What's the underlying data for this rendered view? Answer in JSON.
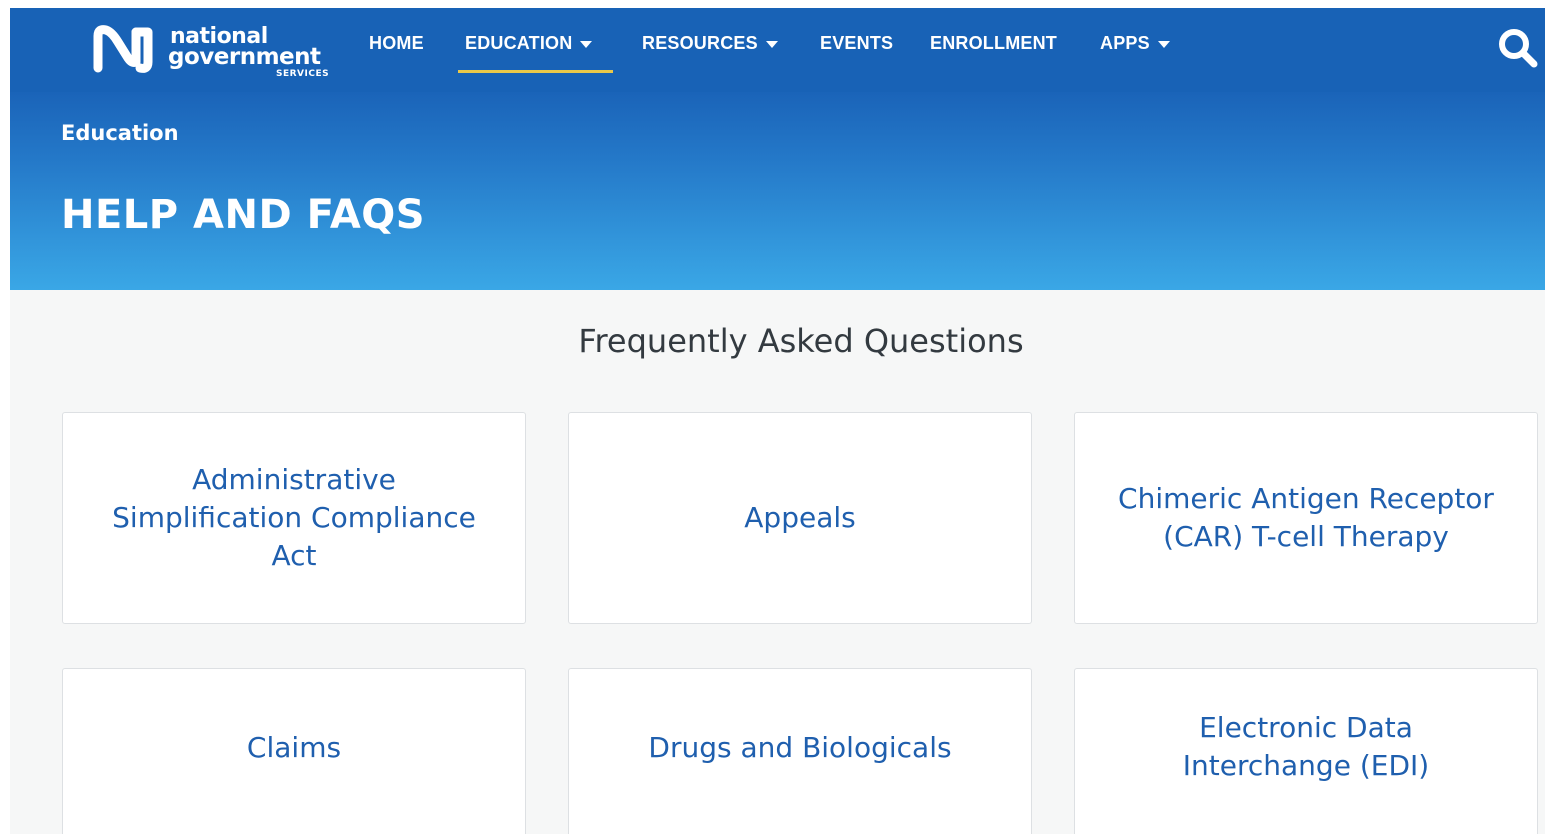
{
  "brand": {
    "line1": "national",
    "line2": "government",
    "line3": "SERVICES"
  },
  "nav": {
    "items": [
      {
        "label": "HOME",
        "has_dropdown": false
      },
      {
        "label": "EDUCATION",
        "has_dropdown": true,
        "active": true
      },
      {
        "label": "RESOURCES",
        "has_dropdown": true
      },
      {
        "label": "EVENTS",
        "has_dropdown": false
      },
      {
        "label": "ENROLLMENT",
        "has_dropdown": false
      },
      {
        "label": "APPS",
        "has_dropdown": true
      }
    ],
    "search_icon": "search-icon",
    "active_underline_color": "#e9c84a"
  },
  "hero": {
    "breadcrumb": "Education",
    "title": "HELP AND FAQS"
  },
  "faq": {
    "heading": "Frequently Asked Questions",
    "cards": [
      {
        "label": "Administrative Simplification Compliance Act"
      },
      {
        "label": "Appeals"
      },
      {
        "label": "Chimeric Antigen Receptor (CAR) T-cell Therapy"
      },
      {
        "label": "Claims"
      },
      {
        "label": "Drugs and Biologicals"
      },
      {
        "label": "Electronic Data Interchange (EDI)"
      }
    ]
  },
  "colors": {
    "nav_bg": "#1862b6",
    "hero_bottom": "#3aa7e6",
    "card_text": "#1f5fae",
    "page_bg": "#f6f7f7"
  }
}
